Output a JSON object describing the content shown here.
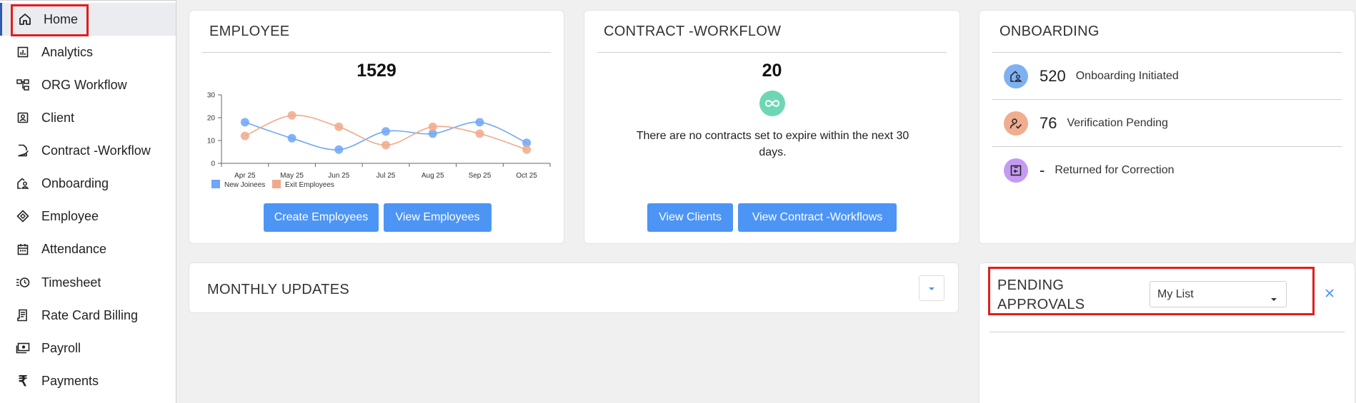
{
  "sidebar": {
    "items": [
      {
        "label": "Home",
        "icon": "home-icon"
      },
      {
        "label": "Analytics",
        "icon": "analytics-icon"
      },
      {
        "label": "ORG Workflow",
        "icon": "org-workflow-icon"
      },
      {
        "label": "Client",
        "icon": "client-icon"
      },
      {
        "label": "Contract -Workflow",
        "icon": "contract-icon"
      },
      {
        "label": "Onboarding",
        "icon": "onboarding-icon"
      },
      {
        "label": "Employee",
        "icon": "employee-icon"
      },
      {
        "label": "Attendance",
        "icon": "calendar-icon"
      },
      {
        "label": "Timesheet",
        "icon": "timesheet-icon"
      },
      {
        "label": "Rate Card Billing",
        "icon": "rate-card-icon"
      },
      {
        "label": "Payroll",
        "icon": "payroll-icon"
      },
      {
        "label": "Payments",
        "icon": "rupee-icon"
      }
    ],
    "active": "Home"
  },
  "employee_card": {
    "title": "EMPLOYEE",
    "total": "1529",
    "create_button": "Create Employees",
    "view_button": "View Employees"
  },
  "contract_card": {
    "title": "CONTRACT -WORKFLOW",
    "total": "20",
    "message": "There are no contracts set to expire within the next 30 days.",
    "view_clients_button": "View Clients",
    "view_contracts_button": "View Contract -Workflows"
  },
  "onboarding_card": {
    "title": "ONBOARDING",
    "rows": [
      {
        "count": "520",
        "label": "Onboarding Initiated",
        "icon": "onboarding-initiated-icon"
      },
      {
        "count": "76",
        "label": "Verification Pending",
        "icon": "verification-pending-icon"
      },
      {
        "count": "-",
        "label": "Returned for Correction",
        "icon": "returned-correction-icon"
      }
    ]
  },
  "monthly_updates": {
    "title": "MONTHLY UPDATES"
  },
  "pending_approvals": {
    "title_line1": "PENDING",
    "title_line2": "APPROVALS",
    "selected": "My List"
  },
  "colors": {
    "accent": "#4d95f5",
    "new_joinees": "#6fa6f5",
    "exit_employees": "#f0a98a",
    "highlight": "#e21d1d"
  },
  "chart_data": {
    "type": "line",
    "categories": [
      "Apr 25",
      "May 25",
      "Jun 25",
      "Jul 25",
      "Aug 25",
      "Sep 25",
      "Oct 25"
    ],
    "series": [
      {
        "name": "New Joinees",
        "values": [
          18,
          11,
          6,
          14,
          13,
          18,
          9
        ]
      },
      {
        "name": "Exit Employees",
        "values": [
          12,
          21,
          16,
          8,
          16,
          13,
          6
        ]
      }
    ],
    "ylim": [
      0,
      30
    ],
    "yticks": [
      0,
      10,
      20,
      30
    ],
    "legend": "bottom-left",
    "grid": false
  }
}
